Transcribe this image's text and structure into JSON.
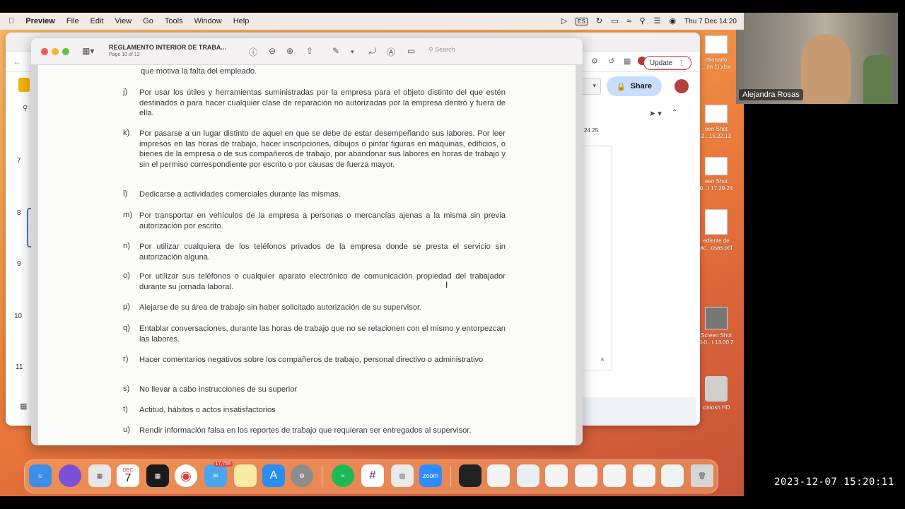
{
  "menubar": {
    "app": "Preview",
    "items": [
      "File",
      "Edit",
      "View",
      "Go",
      "Tools",
      "Window",
      "Help"
    ],
    "input_source": "ES",
    "clock": "Thu 7 Dec  14:20"
  },
  "back_window": {
    "update_label": "Update",
    "share_label": "Share",
    "ruler": "24   25",
    "thumb_numbers": [
      "7",
      "8",
      "9",
      "10",
      "11"
    ],
    "page_number": "8"
  },
  "desktop_icons": [
    {
      "label": "ntionario\n...ón 1).xlsx"
    },
    {
      "label": "een Shot\n2...15.22.13"
    },
    {
      "label": "een Shot\n0...t 17.29.24"
    },
    {
      "label": "ediente de\nac...osas.pdf"
    },
    {
      "label": "Screen Shot\n0-0...t 13.00.2"
    },
    {
      "label": "cintosh HD"
    }
  ],
  "preview": {
    "title": "REGLAMENTO INTERIOR DE TRABA...",
    "subtitle": "Page 10 of 12",
    "search_placeholder": "Search"
  },
  "document": {
    "top_line": "que motiva la falta del empleado.",
    "items": [
      {
        "letter": "j)",
        "text": "Por usar los útiles y herramientas suministradas por la empresa para el objeto distinto del que estén destinados o para hacer cualquier clase de reparación no autorizadas por la empresa dentro y fuera de ella."
      },
      {
        "letter": "k)",
        "text": "Por pasarse a un lugar distinto de aquel en que se debe de estar desempeñando sus labores. Por leer impresos en las horas de trabajo, hacer inscripciones, dibujos o pintar figuras en máquinas, edificios, o bienes de la empresa o de sus compañeros de trabajo, por abandonar sus labores en horas de trabajo y sin el permiso correspondiente por escrito o por causas de fuerza mayor."
      },
      {
        "letter": "l)",
        "text": "Dedicarse a actividades comerciales durante las mismas."
      },
      {
        "letter": "m)",
        "text": "Por transportar en vehículos de la empresa a personas o mercancías ajenas a la misma sin previa autorización por escrito."
      },
      {
        "letter": "n)",
        "text": "Por utilizar cualquiera de los teléfonos privados de la empresa donde se presta el servicio sin autorización alguna."
      },
      {
        "letter": "o)",
        "text": "Por utilizar sus teléfonos o cualquier aparato electrónico de comunicación propiedad del trabajador durante su jornada laboral."
      },
      {
        "letter": "p)",
        "text": "Alejarse de su área de trabajo sin haber solicitado autorización de su supervisor."
      },
      {
        "letter": "q)",
        "text": "Entablar conversaciones, durante las horas de trabajo que no se relacionen con el mismo y entorpezcan las labores."
      },
      {
        "letter": "r)",
        "text": "Hacer comentarios negativos sobre los compañeros de trabajo, personal directivo o administrativo"
      },
      {
        "letter": "s)",
        "text": "No llevar a cabo instrucciones de su superior"
      },
      {
        "letter": "t)",
        "text": "Actitud, hábitos o actos insatisfactorios"
      },
      {
        "letter": "u)",
        "text": "Rendir información falsa en los reportes de trabajo que requieran ser entregados al supervisor."
      }
    ]
  },
  "dock": {
    "calendar_month": "DEC",
    "calendar_day": "7",
    "mail_badge": "17,755",
    "zoom_label": "zoom"
  },
  "video": {
    "participant": "Alejandra Rosas"
  },
  "timestamp": "2023-12-07  15:20:11"
}
